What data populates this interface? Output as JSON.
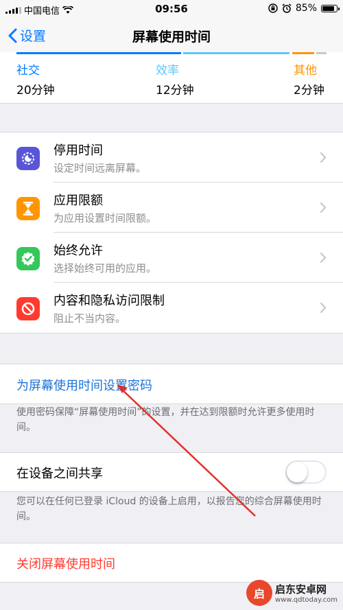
{
  "status": {
    "carrier": "中国电信",
    "time": "09:56",
    "battery": "85%"
  },
  "nav": {
    "back_label": "设置",
    "title": "屏幕使用时间"
  },
  "usage": {
    "categories": [
      {
        "name": "社交",
        "value": "20分钟",
        "color": "#007aff"
      },
      {
        "name": "效率",
        "value": "12分钟",
        "color": "#5ac8fa"
      },
      {
        "name": "其他",
        "value": "2分钟",
        "color": "#ff9500"
      }
    ]
  },
  "settings": [
    {
      "title": "停用时间",
      "subtitle": "设定时间远离屏幕。",
      "icon": "downtime-icon",
      "color": "#5856d6"
    },
    {
      "title": "应用限额",
      "subtitle": "为应用设置时间限额。",
      "icon": "hourglass-icon",
      "color": "#ff9500"
    },
    {
      "title": "始终允许",
      "subtitle": "选择始终可用的应用。",
      "icon": "checkmark-badge-icon",
      "color": "#34c759"
    },
    {
      "title": "内容和隐私访问限制",
      "subtitle": "阻止不当内容。",
      "icon": "restriction-icon",
      "color": "#ff3b30"
    }
  ],
  "passcode": {
    "link_label": "为屏幕使用时间设置密码",
    "note": "使用密码保障“屏幕使用时间”的设置，并在达到限额时允许更多使用时间。"
  },
  "share": {
    "label": "在设备之间共享",
    "enabled": false,
    "note": "您可以在任何已登录 iCloud 的设备上启用，以报告您的综合屏幕使用时间。"
  },
  "close_label": "关闭屏幕使用时间",
  "watermark": {
    "badge": "启",
    "name": "启东安卓网",
    "url": "www.qdtoday.com"
  },
  "colors": {
    "accent": "#007aff",
    "link": "#1a73d8",
    "destructive": "#ff3b30",
    "annotation": "#e0302a"
  }
}
